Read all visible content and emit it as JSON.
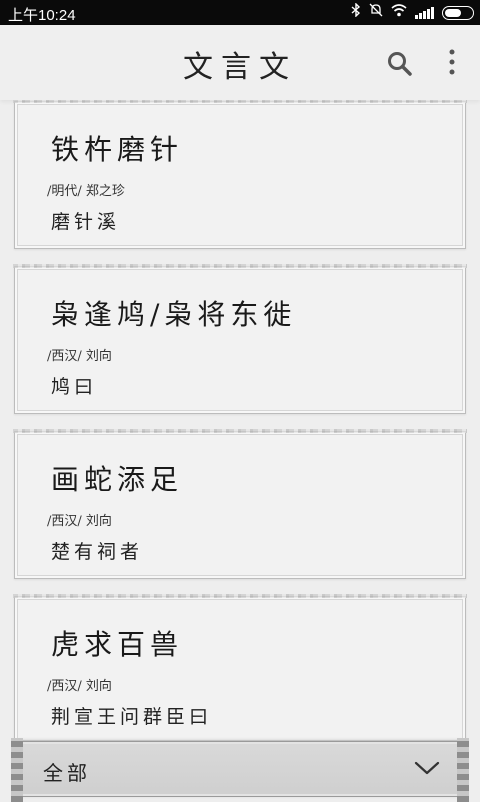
{
  "status_bar": {
    "time": "上午10:24",
    "icons": [
      "bluetooth-icon",
      "mute-icon",
      "wifi-icon",
      "signal-icon",
      "battery-icon"
    ]
  },
  "header": {
    "title": "文言文",
    "actions": [
      "search-icon",
      "more-icon"
    ]
  },
  "articles": [
    {
      "title": "铁杵磨针",
      "meta": "/明代/ 郑之珍",
      "excerpt": "磨针溪"
    },
    {
      "title": "枭逢鸠/枭将东徙",
      "meta": "/西汉/ 刘向",
      "excerpt": "鸠曰"
    },
    {
      "title": "画蛇添足",
      "meta": "/西汉/ 刘向",
      "excerpt": "楚有祠者"
    },
    {
      "title": "虎求百兽",
      "meta": "/西汉/ 刘向",
      "excerpt": "荆宣王问群臣曰"
    }
  ],
  "filter": {
    "selected": "全部",
    "icon": "chevron-down-icon"
  }
}
